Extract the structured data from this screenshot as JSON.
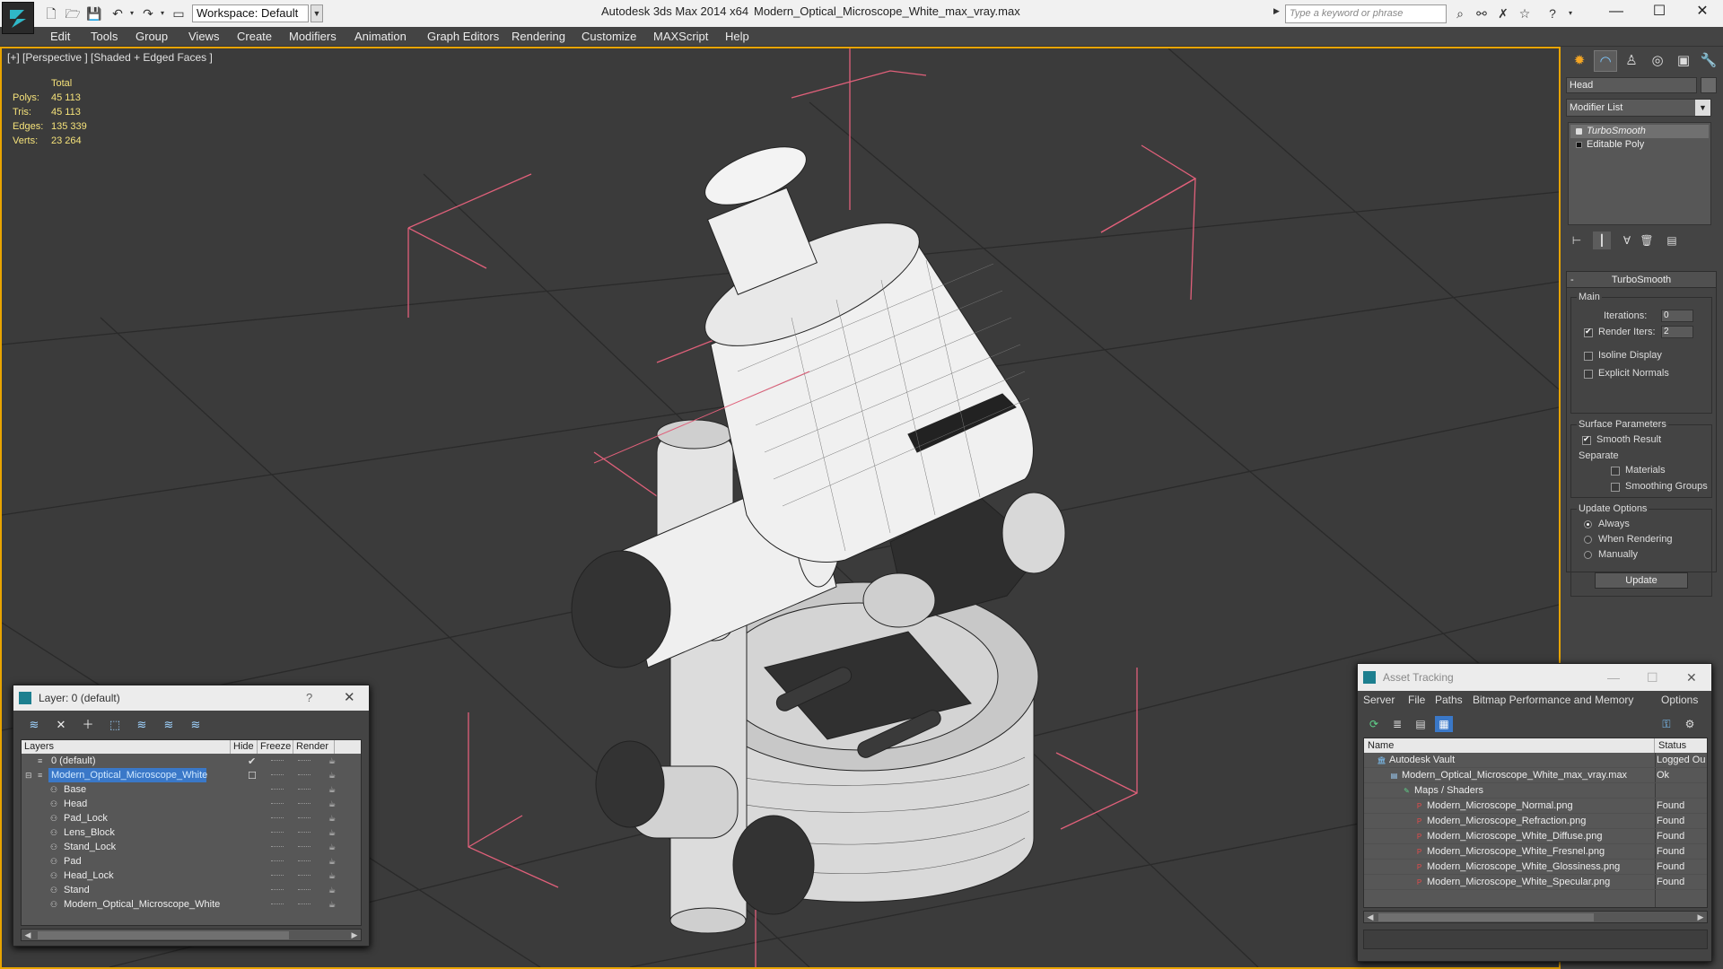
{
  "titlebar": {
    "app_title": "Autodesk 3ds Max  2014 x64",
    "file_title": "Modern_Optical_Microscope_White_max_vray.max",
    "workspace": "Workspace: Default",
    "search_placeholder": "Type a keyword or phrase"
  },
  "menu": [
    "Edit",
    "Tools",
    "Group",
    "Views",
    "Create",
    "Modifiers",
    "Animation",
    "Graph Editors",
    "Rendering",
    "Customize",
    "MAXScript",
    "Help"
  ],
  "viewport": {
    "label": "[+] [Perspective ] [Shaded + Edged Faces ]",
    "stats": {
      "header": "Total",
      "rows": [
        {
          "label": "Polys:",
          "value": "45 113"
        },
        {
          "label": "Tris:",
          "value": "45 113"
        },
        {
          "label": "Edges:",
          "value": "135 339"
        },
        {
          "label": "Verts:",
          "value": "23 264"
        }
      ]
    }
  },
  "command_panel": {
    "object_name": "Head",
    "modifier_list": "Modifier List",
    "stack": [
      "TurboSmooth",
      "Editable Poly"
    ],
    "rollout_title": "TurboSmooth",
    "main_group": "Main",
    "iterations_label": "Iterations:",
    "iterations_value": "0",
    "render_iters_label": "Render Iters:",
    "render_iters_value": "2",
    "render_iters_checked": true,
    "isoline_label": "Isoline Display",
    "explicit_normals_label": "Explicit Normals",
    "surface_group": "Surface Parameters",
    "smooth_result_label": "Smooth Result",
    "separate_label": "Separate",
    "materials_label": "Materials",
    "smoothing_groups_label": "Smoothing Groups",
    "update_group": "Update Options",
    "always_label": "Always",
    "when_rendering_label": "When Rendering",
    "manually_label": "Manually",
    "update_button": "Update"
  },
  "layer_window": {
    "title": "Layer: 0 (default)",
    "help": "?",
    "columns": [
      "Layers",
      "Hide",
      "Freeze",
      "Render"
    ],
    "rows": [
      {
        "name": "0 (default)",
        "level": 0,
        "selected": false,
        "checked": true
      },
      {
        "name": "Modern_Optical_Microscope_White",
        "level": 0,
        "selected": true,
        "checked": false
      },
      {
        "name": "Base",
        "level": 1
      },
      {
        "name": "Head",
        "level": 1
      },
      {
        "name": "Pad_Lock",
        "level": 1
      },
      {
        "name": "Lens_Block",
        "level": 1
      },
      {
        "name": "Stand_Lock",
        "level": 1
      },
      {
        "name": "Pad",
        "level": 1
      },
      {
        "name": "Head_Lock",
        "level": 1
      },
      {
        "name": "Stand",
        "level": 1
      },
      {
        "name": "Modern_Optical_Microscope_White",
        "level": 1
      }
    ]
  },
  "asset_window": {
    "title": "Asset Tracking",
    "menu": [
      "Server",
      "File",
      "Paths",
      "Bitmap Performance and Memory",
      "Options"
    ],
    "columns": [
      "Name",
      "Status"
    ],
    "rows": [
      {
        "name": "Autodesk Vault",
        "status": "Logged Ou",
        "level": 0,
        "icon": "vault"
      },
      {
        "name": "Modern_Optical_Microscope_White_max_vray.max",
        "status": "Ok",
        "level": 1,
        "icon": "file"
      },
      {
        "name": "Maps / Shaders",
        "status": "",
        "level": 2,
        "icon": "maps"
      },
      {
        "name": "Modern_Microscope_Normal.png",
        "status": "Found",
        "level": 3,
        "icon": "png"
      },
      {
        "name": "Modern_Microscope_Refraction.png",
        "status": "Found",
        "level": 3,
        "icon": "png"
      },
      {
        "name": "Modern_Microscope_White_Diffuse.png",
        "status": "Found",
        "level": 3,
        "icon": "png"
      },
      {
        "name": "Modern_Microscope_White_Fresnel.png",
        "status": "Found",
        "level": 3,
        "icon": "png"
      },
      {
        "name": "Modern_Microscope_White_Glossiness.png",
        "status": "Found",
        "level": 3,
        "icon": "png"
      },
      {
        "name": "Modern_Microscope_White_Specular.png",
        "status": "Found",
        "level": 3,
        "icon": "png"
      }
    ]
  },
  "colors": {
    "viewport_border": "#e8a400",
    "stats_text": "#f5e27a",
    "selection": "#3a78c8",
    "bbox_lines": "#e0607a"
  }
}
